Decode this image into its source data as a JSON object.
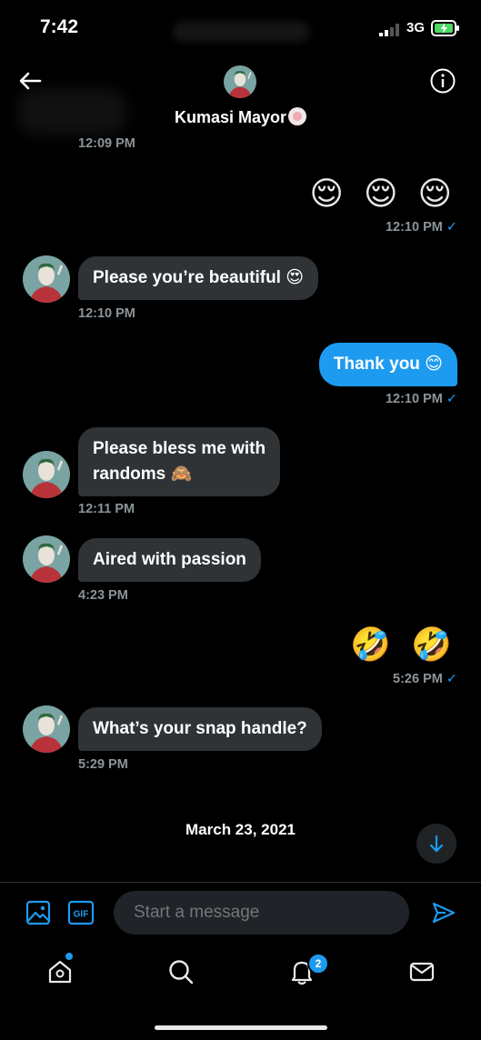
{
  "status_bar": {
    "time": "7:42",
    "network": "3G"
  },
  "header": {
    "title": "Kumasi Mayor"
  },
  "messages": [
    {
      "direction": "in",
      "time": "12:09 PM"
    },
    {
      "direction": "out",
      "text": "😌 😌 😌",
      "time": "12:10 PM",
      "check": "✓"
    },
    {
      "direction": "in",
      "text": "Please you’re beautiful 😍",
      "time": "12:10 PM"
    },
    {
      "direction": "out",
      "text": "Thank you 😊",
      "time": "12:10 PM",
      "check": "✓"
    },
    {
      "direction": "in",
      "text_line1": "Please bless me with",
      "text_line2": "randoms 🙈",
      "time": "12:11 PM"
    },
    {
      "direction": "in",
      "text": "Aired with passion",
      "time": "4:23 PM"
    },
    {
      "direction": "out",
      "text": "🤣 🤣",
      "time": "5:26 PM",
      "check": "✓"
    },
    {
      "direction": "in",
      "text": "What’s your snap handle?",
      "time": "5:29 PM"
    }
  ],
  "date_separator": "March 23, 2021",
  "composer": {
    "placeholder": "Start a message",
    "gif_label": "GIF"
  },
  "tab_bar": {
    "notifications_badge": "2"
  },
  "colors": {
    "accent": "#1d9bf0",
    "bubble_in": "#2f3336",
    "background": "#000000"
  }
}
